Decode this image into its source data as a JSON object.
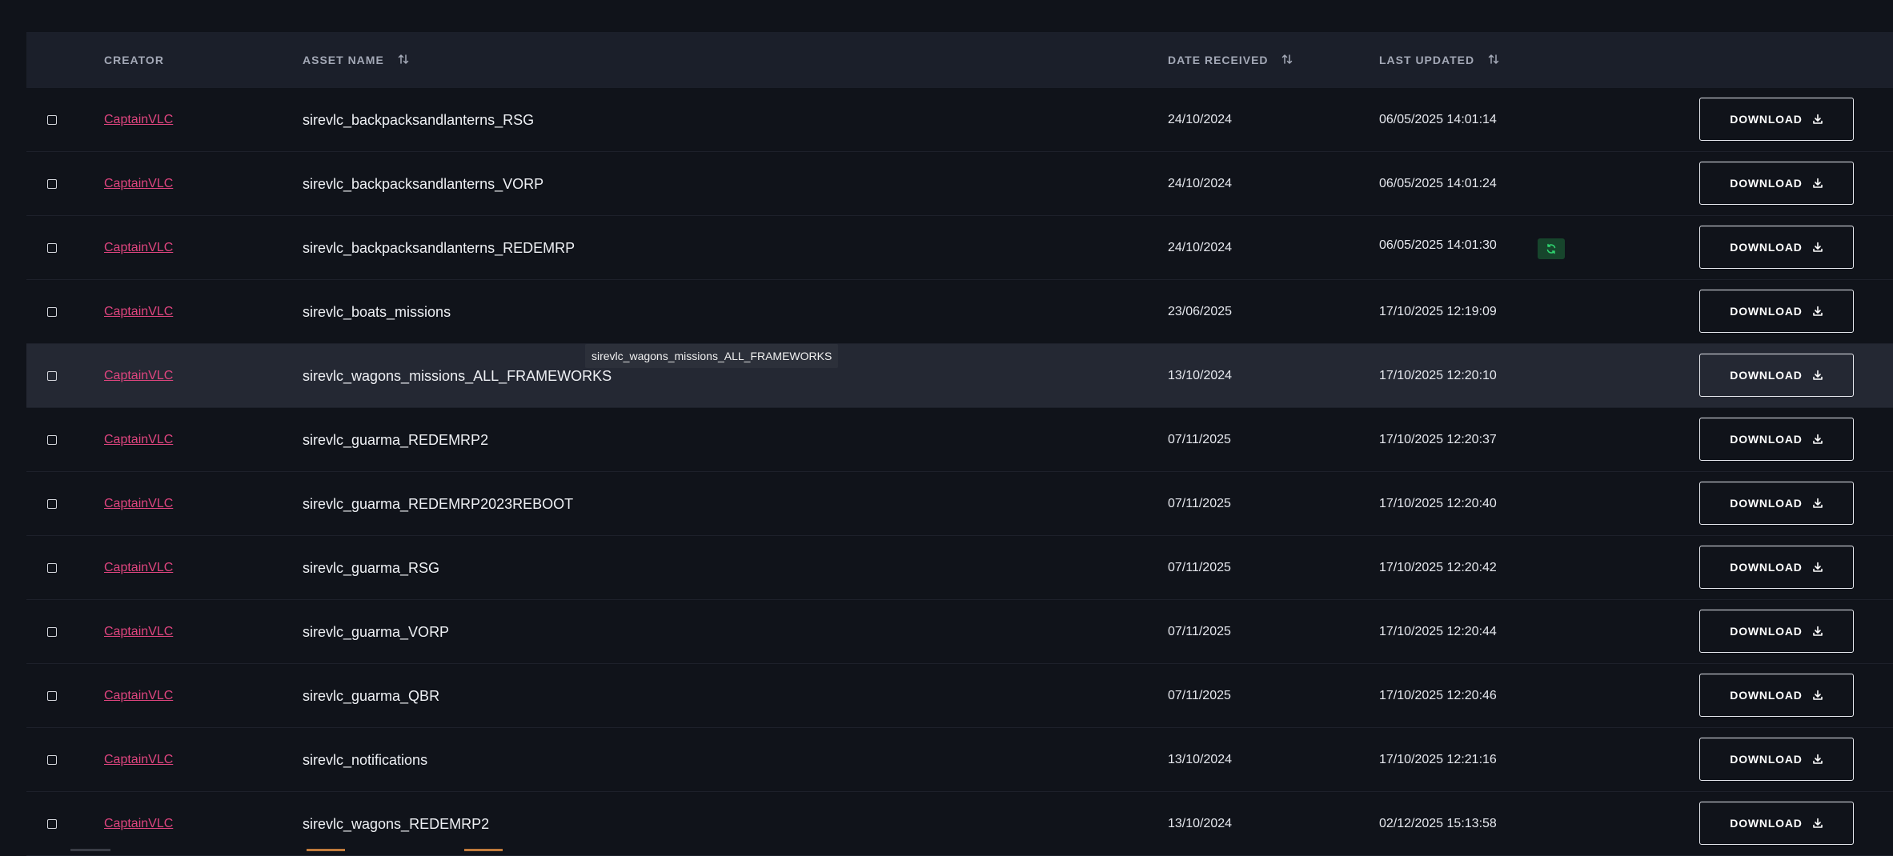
{
  "headers": {
    "creator": "CREATOR",
    "asset_name": "ASSET NAME",
    "date_received": "DATE RECEIVED",
    "last_updated": "LAST UPDATED"
  },
  "download_label": "DOWNLOAD",
  "tooltip": "sirevlc_wagons_missions_ALL_FRAMEWORKS",
  "colors": {
    "background": "#10131a",
    "header": "#1b1f2a",
    "link": "#e0457f",
    "sync_badge": "#17452c",
    "sync_icon": "#2fd36f"
  },
  "rows": [
    {
      "creator": "CaptainVLC",
      "asset": "sirevlc_backpacksandlanterns_RSG",
      "received": "24/10/2024",
      "updated": "06/05/2025 14:01:14"
    },
    {
      "creator": "CaptainVLC",
      "asset": "sirevlc_backpacksandlanterns_VORP",
      "received": "24/10/2024",
      "updated": "06/05/2025 14:01:24"
    },
    {
      "creator": "CaptainVLC",
      "asset": "sirevlc_backpacksandlanterns_REDEMRP",
      "received": "24/10/2024",
      "updated": "06/05/2025 14:01:30",
      "sync_icon": "refresh-icon"
    },
    {
      "creator": "CaptainVLC",
      "asset": "sirevlc_boats_missions",
      "received": "23/06/2025",
      "updated": "17/10/2025 12:19:09"
    },
    {
      "creator": "CaptainVLC",
      "asset": "sirevlc_wagons_missions_ALL_FRAMEWORKS",
      "received": "13/10/2024",
      "updated": "17/10/2025 12:20:10"
    },
    {
      "creator": "CaptainVLC",
      "asset": "sirevlc_guarma_REDEMRP2",
      "received": "07/11/2025",
      "updated": "17/10/2025 12:20:37"
    },
    {
      "creator": "CaptainVLC",
      "asset": "sirevlc_guarma_REDEMRP2023REBOOT",
      "received": "07/11/2025",
      "updated": "17/10/2025 12:20:40"
    },
    {
      "creator": "CaptainVLC",
      "asset": "sirevlc_guarma_RSG",
      "received": "07/11/2025",
      "updated": "17/10/2025 12:20:42"
    },
    {
      "creator": "CaptainVLC",
      "asset": "sirevlc_guarma_VORP",
      "received": "07/11/2025",
      "updated": "17/10/2025 12:20:44"
    },
    {
      "creator": "CaptainVLC",
      "asset": "sirevlc_guarma_QBR",
      "received": "07/11/2025",
      "updated": "17/10/2025 12:20:46"
    },
    {
      "creator": "CaptainVLC",
      "asset": "sirevlc_notifications",
      "received": "13/10/2024",
      "updated": "17/10/2025 12:21:16"
    },
    {
      "creator": "CaptainVLC",
      "asset": "sirevlc_wagons_REDEMRP2",
      "received": "13/10/2024",
      "updated": "02/12/2025 15:13:58"
    }
  ]
}
